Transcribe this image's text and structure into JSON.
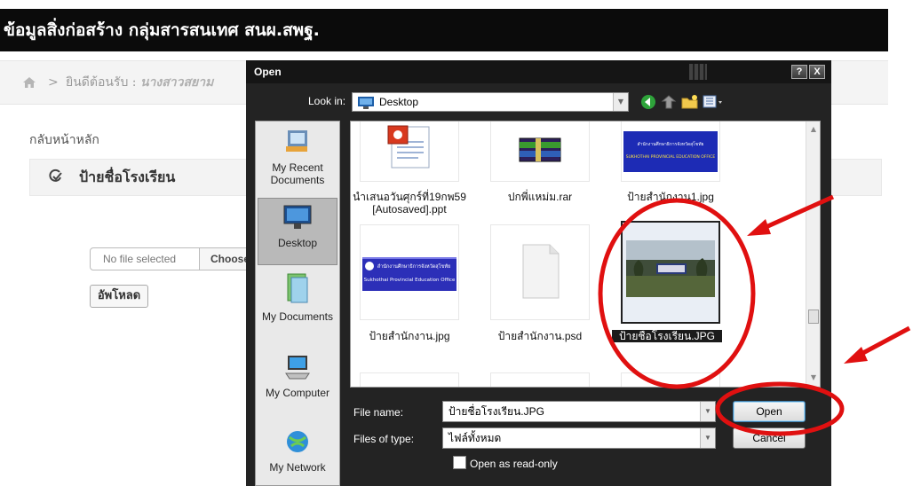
{
  "page": {
    "header_title": "ข้อมูลสิ่งก่อสร้าง กลุ่มสารสนเทศ สนผ.สพฐ.",
    "breadcrumb_sep": ">",
    "welcome_text": "ยินดีต้อนรับ :",
    "welcome_user": "นางสาวสยาม",
    "back_link": "กลับหน้าหลัก",
    "section_title": "ป้ายชื่อโรงเรียน",
    "file_status": "No file selected",
    "choose_button": "Choose",
    "upload_button": "อัพโหลด"
  },
  "dialog": {
    "title": "Open",
    "help_button": "?",
    "close_button": "X",
    "look_in_label": "Look in:",
    "look_in_value": "Desktop",
    "places": [
      {
        "label": "My Recent Documents",
        "icon": "recent-documents-icon"
      },
      {
        "label": "Desktop",
        "icon": "desktop-icon"
      },
      {
        "label": "My Documents",
        "icon": "my-documents-icon"
      },
      {
        "label": "My Computer",
        "icon": "my-computer-icon"
      },
      {
        "label": "My Network",
        "icon": "my-network-icon"
      }
    ],
    "files": [
      {
        "name": "นำเสนอวันศุกร์ที่19กพ59 [Autosaved].ppt",
        "type": "ppt"
      },
      {
        "name": "ปกพี่แหม่ม.rar",
        "type": "rar"
      },
      {
        "name": "ป้ายสำนักงาน1.jpg",
        "type": "jpg"
      },
      {
        "name": "ป้ายสำนักงาน.jpg",
        "type": "jpg"
      },
      {
        "name": "ป้ายสำนักงาน.psd",
        "type": "psd"
      },
      {
        "name": "ป้ายชื่อโรงเรียน.JPG",
        "type": "jpg",
        "selected": true
      }
    ],
    "file_name_label": "File name:",
    "file_name_value": "ป้ายชื่อโรงเรียน.JPG",
    "files_of_type_label": "Files of type:",
    "files_of_type_value": "ไฟล์ทั้งหมด",
    "read_only_label": "Open as read-only",
    "open_button": "Open",
    "cancel_button": "Cancel"
  },
  "thumb_text": {
    "banner_line1": "สำนักงานศึกษาธิการจังหวัดสุโขทัย",
    "banner_line2": "Sukhothai Provincial Education Office",
    "banner_top_caps": "SUKHOTHAI PROVINCIAL EDUCATION OFFICE"
  },
  "colors": {
    "annotation": "#e01010",
    "header_bg": "#0b0b0b",
    "dialog_bg": "#232323"
  }
}
